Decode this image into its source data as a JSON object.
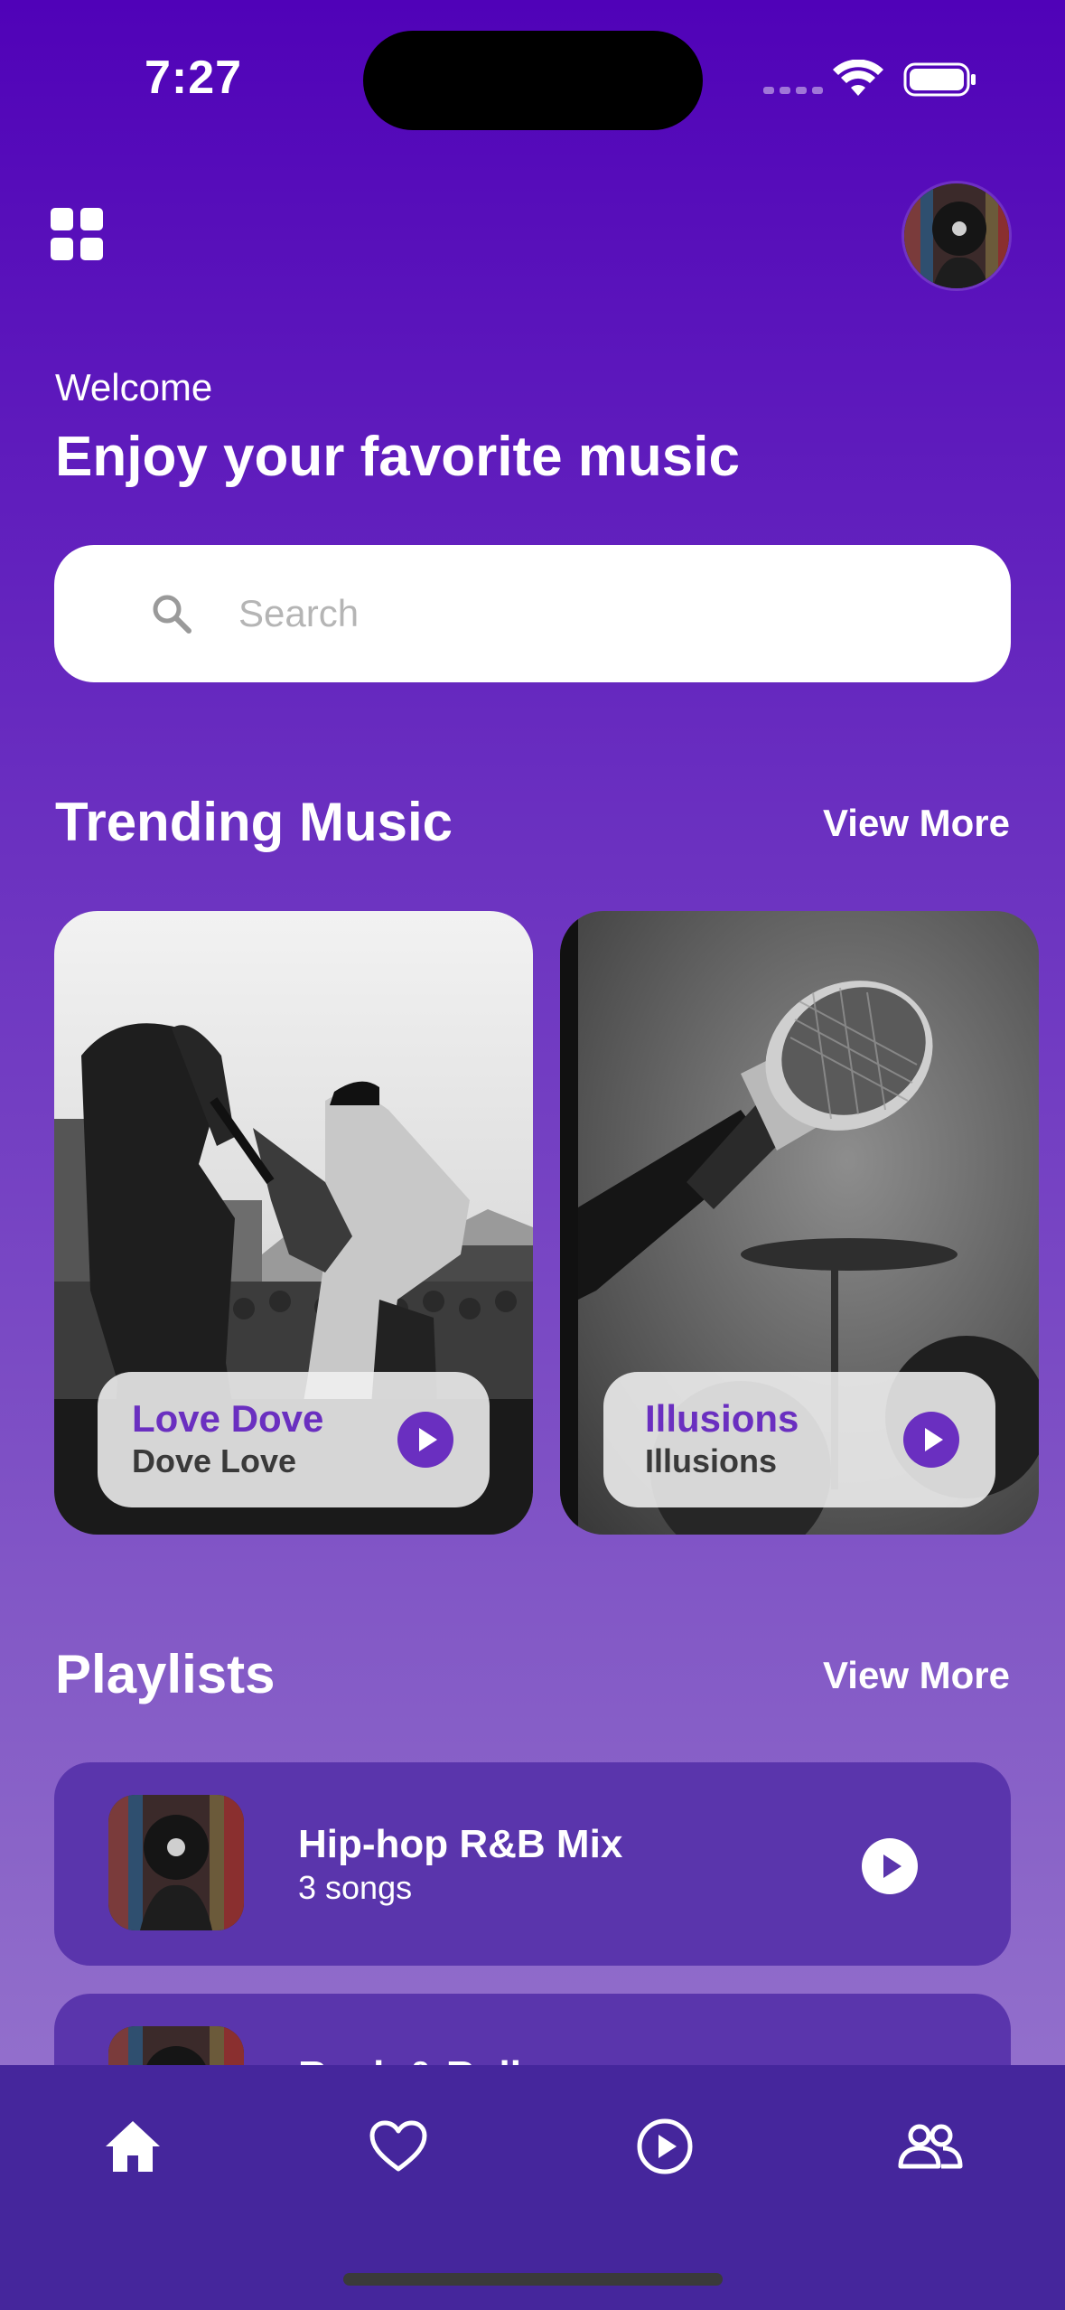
{
  "status_bar": {
    "time": "7:27"
  },
  "header": {
    "welcome": "Welcome",
    "headline": "Enjoy your favorite music"
  },
  "search": {
    "placeholder": "Search",
    "value": ""
  },
  "trending": {
    "title": "Trending Music",
    "view_more": "View More",
    "cards": [
      {
        "title": "Love Dove",
        "artist": "Dove Love"
      },
      {
        "title": "Illusions",
        "artist": "Illusions"
      }
    ]
  },
  "playlists": {
    "title": "Playlists",
    "view_more": "View More",
    "items": [
      {
        "name": "Hip-hop R&B Mix",
        "count": "3 songs"
      },
      {
        "name": "Rock & Roll",
        "count": ""
      }
    ]
  },
  "nav": {
    "items": [
      {
        "icon": "home-icon",
        "active": true
      },
      {
        "icon": "heart-icon",
        "active": false
      },
      {
        "icon": "play-circle-icon",
        "active": false
      },
      {
        "icon": "people-icon",
        "active": false
      }
    ]
  },
  "colors": {
    "accent": "#6a2fc0",
    "background_top": "#5002b8",
    "nav_background": "#45269c",
    "playlist_card": "#5a35ac"
  }
}
